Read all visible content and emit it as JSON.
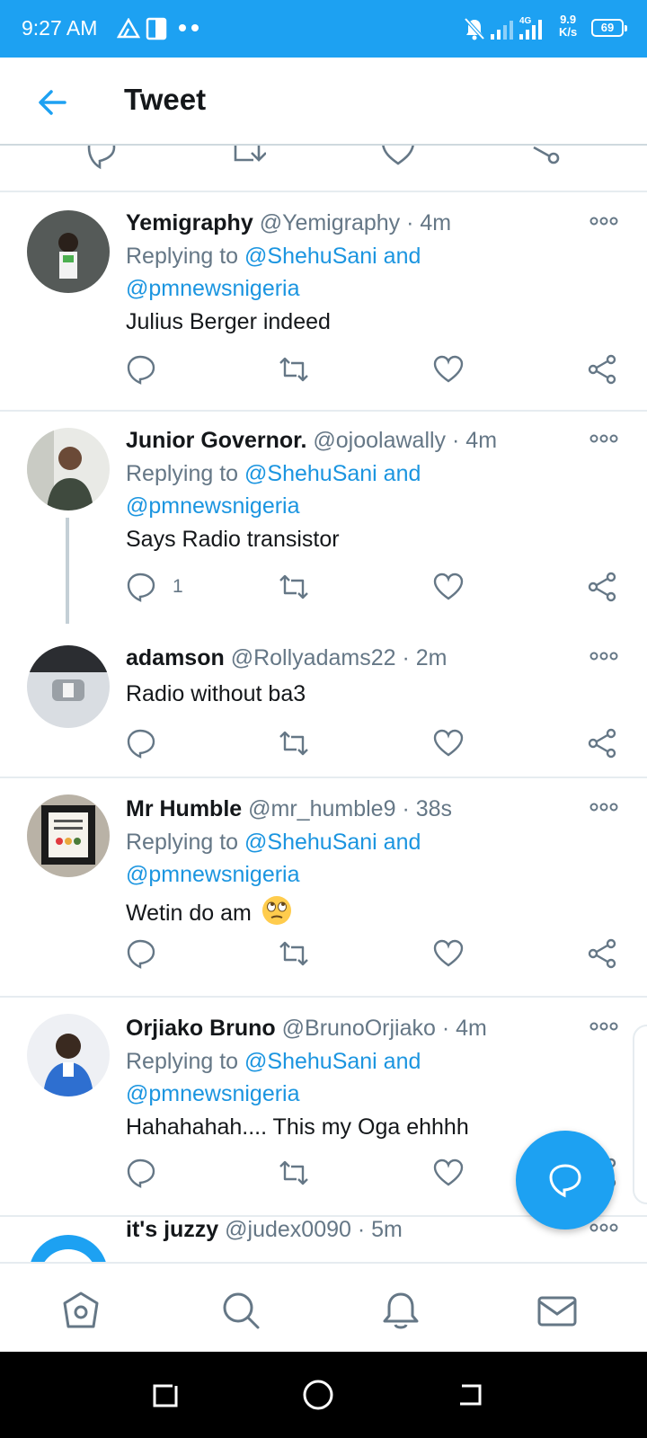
{
  "status_bar": {
    "time": "9:27 AM",
    "network": "4G",
    "speed_value": "9.9",
    "speed_unit": "K/s",
    "battery": "69",
    "icons": [
      "drive-icon",
      "document-icon",
      "dots-icon",
      "mute-icon",
      "signal-icon",
      "signal-4g-icon"
    ]
  },
  "header": {
    "title": "Tweet",
    "back_icon": "arrow-left-icon"
  },
  "tweets": [
    {
      "name": "Yemigraphy",
      "handle": "@Yemigraphy",
      "time": "· 4m",
      "replying_prefix": "Replying to",
      "replying_to": "@ShehuSani and",
      "replying_to_2": "@pmnewsnigeria",
      "text": "Julius Berger indeed",
      "reply_count": ""
    },
    {
      "name": "Junior Governor.",
      "handle": "@ojoolawally",
      "time": "· 4m",
      "replying_prefix": "Replying to",
      "replying_to": "@ShehuSani and",
      "replying_to_2": "@pmnewsnigeria",
      "text": "Says Radio transistor",
      "reply_count": "1"
    },
    {
      "name": "adamson",
      "handle": "@Rollyadams22",
      "time": "· 2m",
      "text": "Radio without ba3",
      "reply_count": ""
    },
    {
      "name": "Mr Humble",
      "handle": "@mr_humble9",
      "time": "· 38s",
      "replying_prefix": "Replying to",
      "replying_to": "@ShehuSani and",
      "replying_to_2": "@pmnewsnigeria",
      "text": "Wetin do am",
      "emoji": "face-with-rolling-eyes",
      "reply_count": ""
    },
    {
      "name": "Orjiako Bruno",
      "handle": "@BrunoOrjiako",
      "time": "· 4m",
      "replying_prefix": "Replying to",
      "replying_to": "@ShehuSani and",
      "replying_to_2": "@pmnewsnigeria",
      "text": "Hahahahah.... This my Oga ehhhh",
      "reply_count": ""
    },
    {
      "name": "it's juzzy",
      "handle": "@judex0090",
      "time": "· 5m"
    }
  ],
  "bottom_nav": [
    "home-icon",
    "search-icon",
    "notifications-icon",
    "messages-icon"
  ],
  "colors": {
    "accent": "#1da1f2",
    "link": "#1b95e0",
    "secondary_text": "#657786",
    "divider": "#e6ecf0"
  }
}
